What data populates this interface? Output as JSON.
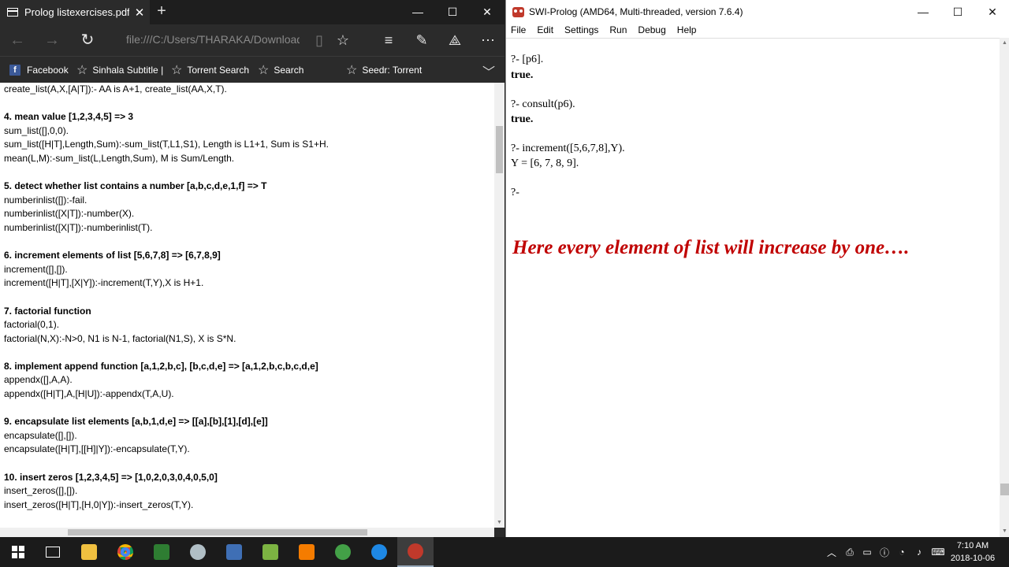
{
  "edge": {
    "tab_title": "Prolog listexercises.pdf",
    "address": "file:///C:/Users/THARAKA/Downloads/Dc",
    "favorites": [
      {
        "label": "Facebook",
        "icon": "facebook-icon"
      },
      {
        "label": "Sinhala Subtitle |",
        "icon": "star-icon"
      },
      {
        "label": "Torrent Search",
        "icon": "star-icon"
      },
      {
        "label": "Search",
        "icon": "star-icon"
      },
      {
        "label": "Seedr: Torrent",
        "icon": "star-icon"
      }
    ],
    "pdf_lines": [
      {
        "text": "create_list(A,X,[A|T]):- AA is A+1, create_list(AA,X,T).",
        "bold": false
      },
      {
        "text": "",
        "bold": false
      },
      {
        "text": "4. mean value [1,2,3,4,5] => 3",
        "bold": true
      },
      {
        "text": "sum_list([],0,0).",
        "bold": false
      },
      {
        "text": "sum_list([H|T],Length,Sum):-sum_list(T,L1,S1), Length is L1+1, Sum is S1+H.",
        "bold": false
      },
      {
        "text": "mean(L,M):-sum_list(L,Length,Sum), M is Sum/Length.",
        "bold": false
      },
      {
        "text": "",
        "bold": false
      },
      {
        "text": "5. detect whether list contains a number [a,b,c,d,e,1,f] => T",
        "bold": true
      },
      {
        "text": "numberinlist([]):-fail.",
        "bold": false
      },
      {
        "text": "numberinlist([X|T]):-number(X).",
        "bold": false
      },
      {
        "text": "numberinlist([X|T]):-numberinlist(T).",
        "bold": false
      },
      {
        "text": "",
        "bold": false
      },
      {
        "text": "6. increment elements of list [5,6,7,8] => [6,7,8,9]",
        "bold": true
      },
      {
        "text": "increment([],[]).",
        "bold": false
      },
      {
        "text": "increment([H|T],[X|Y]):-increment(T,Y),X is H+1.",
        "bold": false
      },
      {
        "text": "",
        "bold": false
      },
      {
        "text": "7. factorial function",
        "bold": true
      },
      {
        "text": "factorial(0,1).",
        "bold": false
      },
      {
        "text": "factorial(N,X):-N>0, N1 is N-1, factorial(N1,S), X is S*N.",
        "bold": false
      },
      {
        "text": "",
        "bold": false
      },
      {
        "text": "8. implement append function [a,1,2,b,c], [b,c,d,e] => [a,1,2,b,c,b,c,d,e]",
        "bold": true
      },
      {
        "text": "appendx([],A,A).",
        "bold": false
      },
      {
        "text": "appendx([H|T],A,[H|U]):-appendx(T,A,U).",
        "bold": false
      },
      {
        "text": "",
        "bold": false
      },
      {
        "text": "9. encapsulate list elements [a,b,1,d,e] => [[a],[b],[1],[d],[e]]",
        "bold": true
      },
      {
        "text": "encapsulate([],[]).",
        "bold": false
      },
      {
        "text": "encapsulate([H|T],[[H]|Y]):-encapsulate(T,Y).",
        "bold": false
      },
      {
        "text": "",
        "bold": false
      },
      {
        "text": "10. insert zeros [1,2,3,4,5] => [1,0,2,0,3,0,4,0,5,0]",
        "bold": true
      },
      {
        "text": "insert_zeros([],[]).",
        "bold": false
      },
      {
        "text": "insert_zeros([H|T],[H,0|Y]):-insert_zeros(T,Y).",
        "bold": false
      }
    ]
  },
  "swi": {
    "title": "SWI-Prolog (AMD64, Multi-threaded, version 7.6.4)",
    "menu": [
      "File",
      "Edit",
      "Settings",
      "Run",
      "Debug",
      "Help"
    ],
    "console": [
      {
        "text": "?- [p6].",
        "bold": false
      },
      {
        "text": "true.",
        "bold": true
      },
      {
        "text": "?- consult(p6).",
        "bold": false
      },
      {
        "text": "true.",
        "bold": true
      },
      {
        "text": "?- increment([5,6,7,8],Y).",
        "bold": false
      },
      {
        "text": "Y = [6, 7, 8, 9].",
        "bold": false
      },
      {
        "text": "?-",
        "bold": false
      }
    ],
    "annotation": "Here every element of list will increase by one….",
    "annotation_color": "#c00000"
  },
  "taskbar": {
    "clock_time": "7:10 AM",
    "clock_date": "2018-10-06"
  }
}
